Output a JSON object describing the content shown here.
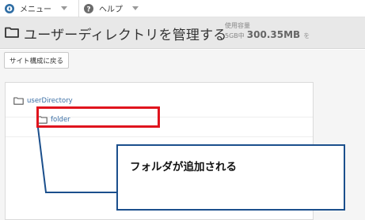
{
  "menubar": {
    "items": [
      {
        "label": "メニュー",
        "icon": "compass-icon"
      },
      {
        "label": "ヘルプ",
        "icon": "question-icon"
      }
    ]
  },
  "header": {
    "title": "ユーザーディレクトリを管理する",
    "usage": {
      "label": "使用容量",
      "capacity": "5GB中",
      "value": "300.35MB",
      "more": "を"
    }
  },
  "toolbar": {
    "back_label": "サイト構成に戻る"
  },
  "tree": {
    "root": {
      "label": "userDirectory",
      "icon": "folder-icon"
    },
    "child": {
      "label": "folder",
      "icon": "folder-icon"
    }
  },
  "annotation": {
    "callout_text": "フォルダが追加される",
    "highlight_color": "#e0141e",
    "callout_border_color": "#1b4f8c"
  },
  "colors": {
    "link": "#3a6ea5",
    "title_bar": "#e8e8e8",
    "icon_blue": "#2e6da4"
  }
}
